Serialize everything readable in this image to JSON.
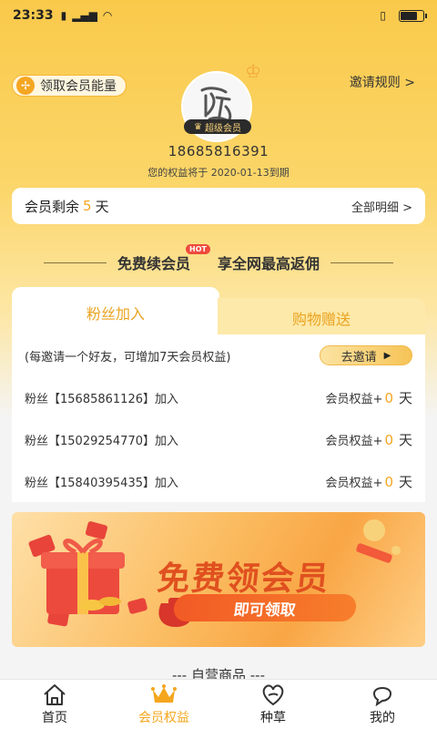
{
  "status_bar": {
    "time": "23:33"
  },
  "header": {
    "energy_button": "领取会员能量",
    "invite_rules": "邀请规则 >",
    "vip_badge": "超级会员",
    "phone": "18685816391",
    "expire_text": "您的权益将于 2020-01-13到期"
  },
  "membership": {
    "remain_label": "会员剩余",
    "remain_days": "5",
    "remain_unit": "天",
    "detail_link": "全部明细 >"
  },
  "promo": {
    "free_renew": "免费续会员",
    "hot_badge": "HOT",
    "max_commission": "享全网最高返佣"
  },
  "tabs": [
    {
      "label": "粉丝加入",
      "active": true
    },
    {
      "label": "购物赠送",
      "active": false
    }
  ],
  "invite": {
    "hint": "(每邀请一个好友，可增加7天会员权益)",
    "button": "去邀请"
  },
  "fans": [
    {
      "label": "粉丝【15685861126】加入",
      "benefit_prefix": "会员权益+",
      "benefit_value": "0",
      "unit": "天"
    },
    {
      "label": "粉丝【15029254770】加入",
      "benefit_prefix": "会员权益+",
      "benefit_value": "0",
      "unit": "天"
    },
    {
      "label": "粉丝【15840395435】加入",
      "benefit_prefix": "会员权益+",
      "benefit_value": "0",
      "unit": "天"
    }
  ],
  "banner": {
    "title": "免费领会员",
    "button": "即可领取"
  },
  "section_title": "--- 自营商品 ---",
  "bottom_nav": [
    {
      "label": "首页",
      "icon": "home-icon",
      "active": false
    },
    {
      "label": "会员权益",
      "icon": "crown-icon",
      "active": true
    },
    {
      "label": "种草",
      "icon": "heart-leaf-icon",
      "active": false
    },
    {
      "label": "我的",
      "icon": "profile-icon",
      "active": false
    }
  ],
  "colors": {
    "accent": "#f5a623",
    "tab_text": "#e9a321",
    "banner_red": "#e0501f"
  }
}
